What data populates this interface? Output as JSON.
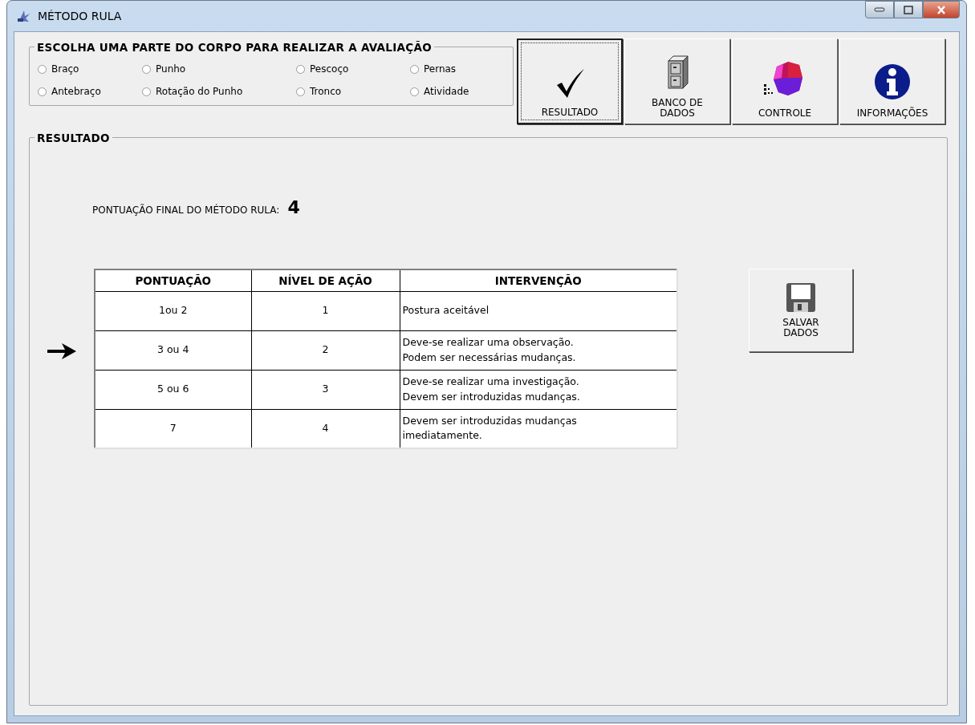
{
  "window": {
    "title": "MÉTODO RULA"
  },
  "body_part_group": {
    "title": "ESCOLHA UMA PARTE DO CORPO PARA REALIZAR A AVALIAÇÃO",
    "options": [
      {
        "label": "Braço",
        "selected": false
      },
      {
        "label": "Punho",
        "selected": false
      },
      {
        "label": "Pescoço",
        "selected": false
      },
      {
        "label": "Pernas",
        "selected": false
      },
      {
        "label": "Antebraço",
        "selected": false
      },
      {
        "label": "Rotação do Punho",
        "selected": false
      },
      {
        "label": "Tronco",
        "selected": false
      },
      {
        "label": "Atividade",
        "selected": false
      }
    ]
  },
  "toolbar": [
    {
      "kind": "check",
      "label": "RESULTADO",
      "selected": true
    },
    {
      "kind": "cabinet",
      "label": "BANCO DE\nDADOS",
      "selected": false
    },
    {
      "kind": "chart",
      "label": "CONTROLE",
      "selected": false
    },
    {
      "kind": "info",
      "label": "INFORMAÇÕES",
      "selected": false
    }
  ],
  "result": {
    "title": "RESULTADO",
    "score_label": "PONTUAÇÃO FINAL DO MÉTODO RULA:",
    "score": "4",
    "table": {
      "columns": [
        "PONTUAÇÃO",
        "NÍVEL DE AÇÃO",
        "INTERVENÇÃO"
      ],
      "rows": [
        {
          "cells": [
            "1ou 2",
            "1",
            "Postura aceitável"
          ],
          "selected": false
        },
        {
          "cells": [
            "3 ou 4",
            "2",
            "Deve-se realizar uma observação.\nPodem ser necessárias mudanças."
          ],
          "selected": true
        },
        {
          "cells": [
            "5 ou 6",
            "3",
            "Deve-se realizar uma investigação.\nDevem ser introduzidas mudanças."
          ],
          "selected": false
        },
        {
          "cells": [
            "7",
            "4",
            "Devem ser introduzidas mudanças\nimediatamente."
          ],
          "selected": false
        }
      ]
    },
    "save_button": {
      "label": "SALVAR\nDADOS"
    }
  }
}
